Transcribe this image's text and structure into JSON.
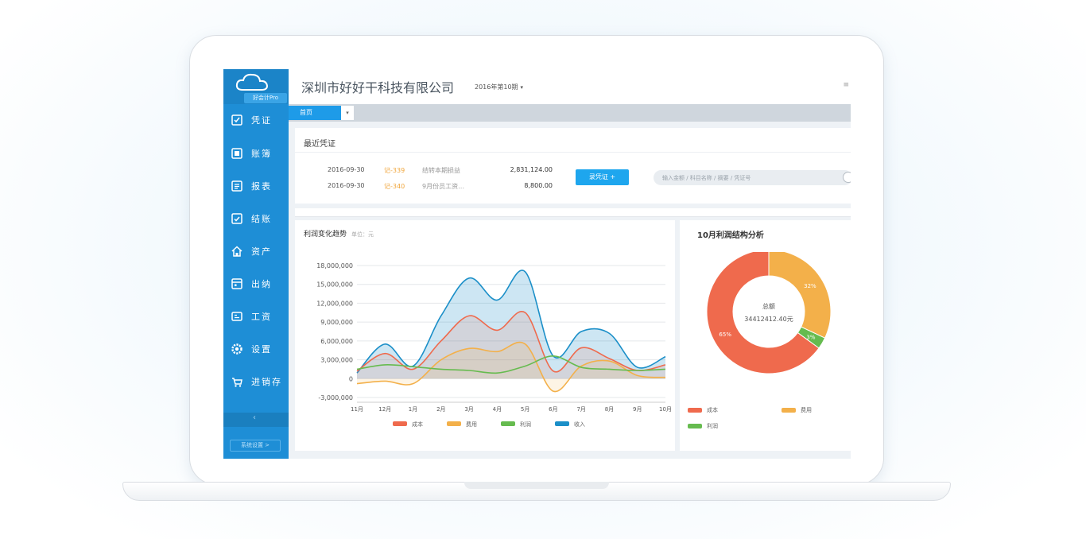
{
  "colors": {
    "sidebar": "#1e8ed6",
    "cost": "#ef6a4d",
    "expense": "#f3b04a",
    "profit": "#66bb4f",
    "income": "#1b8fc8",
    "accent_button": "#1ea6ee"
  },
  "sidebar": {
    "logo_text": "好会计Pro",
    "items": [
      {
        "label": "凭证",
        "icon": "voucher-icon"
      },
      {
        "label": "账簿",
        "icon": "ledger-icon"
      },
      {
        "label": "报表",
        "icon": "report-icon"
      },
      {
        "label": "结账",
        "icon": "checkout-icon"
      },
      {
        "label": "资产",
        "icon": "asset-icon"
      },
      {
        "label": "出纳",
        "icon": "cashier-icon"
      },
      {
        "label": "工资",
        "icon": "salary-icon"
      },
      {
        "label": "设置",
        "icon": "gear-icon"
      },
      {
        "label": "进销存",
        "icon": "inventory-icon"
      }
    ],
    "collapse_label": "‹",
    "bottom_button": "系统设置 >"
  },
  "header": {
    "company": "深圳市好好干科技有限公司",
    "period": "2016年第10期",
    "right_icon": "≡"
  },
  "tabs": {
    "active": "首页",
    "caret": "▾"
  },
  "recent": {
    "title": "最近凭证",
    "rows": [
      {
        "date": "2016-09-30",
        "no": "记-339",
        "desc": "结转本期损益",
        "amount": "2,831,124.00"
      },
      {
        "date": "2016-09-30",
        "no": "记-340",
        "desc": "9月份员工资…",
        "amount": "8,800.00"
      }
    ],
    "add_button": "录凭证 +",
    "search_placeholder": "输入金额 / 科目名称 / 摘要 / 凭证号"
  },
  "profit_chart": {
    "title": "利润变化趋势",
    "unit": "单位：元"
  },
  "pie_chart": {
    "title": "10月利润结构分析",
    "center_label": "总额",
    "center_value": "34412412.40元",
    "legend": [
      "成本",
      "费用",
      "利润"
    ]
  },
  "chart_data": [
    {
      "type": "area",
      "title": "利润变化趋势",
      "categories": [
        "11月",
        "12月",
        "1月",
        "2月",
        "3月",
        "4月",
        "5月",
        "6月",
        "7月",
        "8月",
        "9月",
        "10月"
      ],
      "ylim": [
        -3000000,
        18000000
      ],
      "yticks": [
        "18,000,000",
        "15,000,000",
        "12,000,000",
        "9,000,000",
        "6,000,000",
        "3,000,000",
        "0",
        "-3,000,000"
      ],
      "ytick_values": [
        18000000,
        15000000,
        12000000,
        9000000,
        6000000,
        3000000,
        0,
        -3000000
      ],
      "grid": true,
      "legend_position": "bottom",
      "series": [
        {
          "name": "成本",
          "values": [
            1200000,
            4000000,
            1500000,
            6000000,
            10000000,
            7700000,
            10500000,
            1200000,
            4900000,
            3200000,
            1300000,
            2200000
          ]
        },
        {
          "name": "费用",
          "values": [
            -800000,
            -400000,
            -800000,
            3000000,
            4800000,
            4300000,
            5500000,
            -2000000,
            2000000,
            2800000,
            500000,
            200000
          ]
        },
        {
          "name": "利润",
          "values": [
            1500000,
            2200000,
            1900000,
            1500000,
            1300000,
            900000,
            2000000,
            3600000,
            1800000,
            1500000,
            1300000,
            1500000
          ]
        },
        {
          "name": "收入",
          "values": [
            900000,
            5500000,
            2000000,
            10000000,
            16000000,
            12500000,
            17000000,
            3600000,
            7500000,
            7200000,
            1800000,
            3500000
          ]
        }
      ]
    },
    {
      "type": "pie",
      "title": "10月利润结构分析",
      "categories": [
        "成本",
        "费用",
        "利润"
      ],
      "values": [
        65,
        32,
        3
      ],
      "labels": [
        "65%",
        "32%",
        "3%"
      ],
      "legend_position": "bottom"
    }
  ]
}
